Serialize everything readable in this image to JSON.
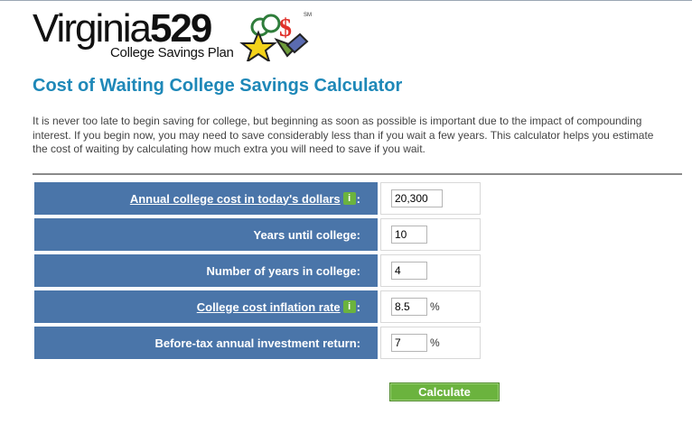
{
  "logo": {
    "brand": "Virginia",
    "number": "529",
    "subtitle": "College Savings Plan",
    "trademark": "SM"
  },
  "page": {
    "title": "Cost of Waiting College Savings Calculator",
    "intro": "It is never too late to begin saving for college, but beginning as soon as possible is important due to the impact of compounding interest. If you begin now, you may need to save considerably less than if you wait a few years. This calculator helps you estimate the cost of waiting by calculating how much extra you will need to save if you wait."
  },
  "form": {
    "rows": [
      {
        "label": "Annual college cost in today's dollars",
        "linked": true,
        "info": true,
        "value": "20,300",
        "unit": ""
      },
      {
        "label": "Years until college:",
        "linked": false,
        "info": false,
        "value": "10",
        "unit": ""
      },
      {
        "label": "Number of years in college:",
        "linked": false,
        "info": false,
        "value": "4",
        "unit": ""
      },
      {
        "label": "College cost inflation rate",
        "linked": true,
        "info": true,
        "value": "8.5",
        "unit": "%"
      },
      {
        "label": "Before-tax annual investment return:",
        "linked": false,
        "info": false,
        "value": "7",
        "unit": "%"
      }
    ],
    "info_glyph": "i",
    "colon": ":",
    "calculate_label": "Calculate"
  },
  "colors": {
    "title": "#1e88b8",
    "label_bg": "#4a75a9",
    "button_green": "#6bb33e"
  }
}
